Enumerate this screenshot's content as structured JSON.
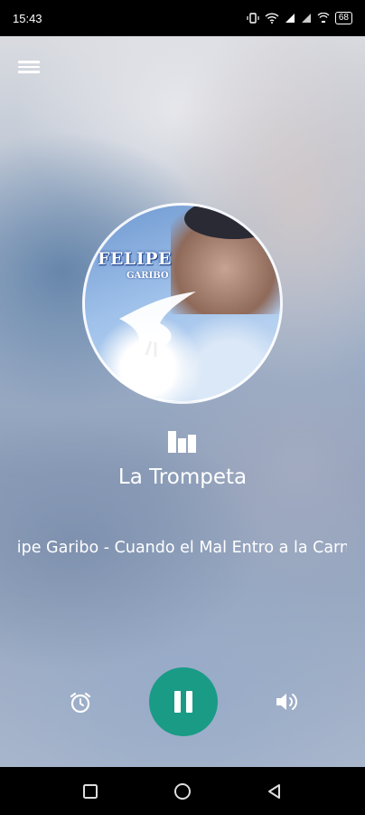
{
  "status_bar": {
    "time": "15:43",
    "battery": "68",
    "icons": [
      "vibrate-icon",
      "wifi-icon",
      "signal-icon",
      "signal-icon",
      "wifi-calling-icon",
      "battery-icon"
    ]
  },
  "menu": {
    "icon": "hamburger-menu-icon"
  },
  "album_art": {
    "title_text": "FELIPE",
    "subtitle_text": "GARIBO"
  },
  "player": {
    "station_name": "La Trompeta",
    "track_title": "Felipe Garibo - Cuando el Mal Entro a la Carne",
    "state": "playing",
    "accent_color": "#1a9b86"
  },
  "controls": {
    "alarm_icon": "alarm-clock-icon",
    "play_pause_icon": "pause-icon",
    "volume_icon": "volume-icon"
  },
  "nav_bar": {
    "items": [
      "recents-icon",
      "home-icon",
      "back-icon"
    ]
  }
}
